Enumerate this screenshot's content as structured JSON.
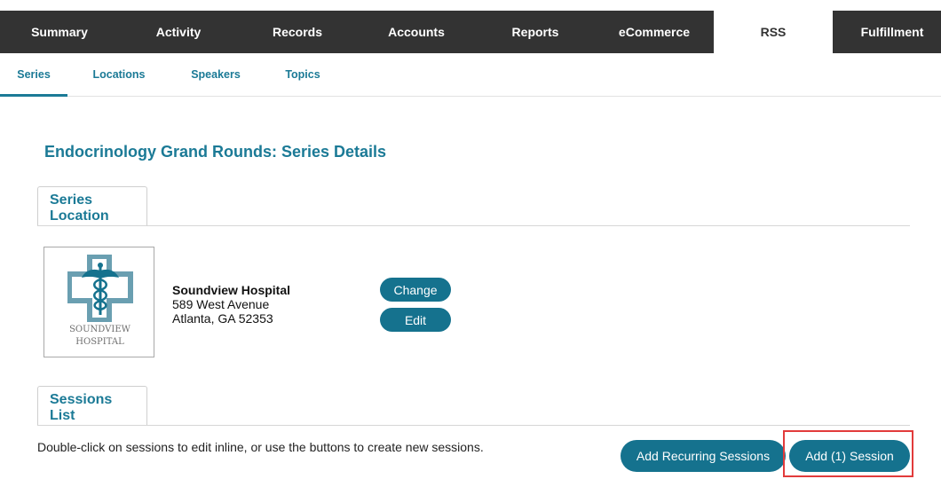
{
  "top_nav": {
    "tabs": [
      "Summary",
      "Activity",
      "Records",
      "Accounts",
      "Reports",
      "eCommerce",
      "RSS",
      "Fulfillment"
    ],
    "active": "RSS"
  },
  "sub_nav": {
    "tabs": [
      "Series",
      "Locations",
      "Speakers",
      "Topics"
    ],
    "active": "Series"
  },
  "page": {
    "title": "Endocrinology Grand Rounds: Series Details"
  },
  "series_location": {
    "tab_label": "Series Location",
    "logo": {
      "line1": "SOUNDVIEW",
      "line2": "HOSPITAL",
      "icon": "medical-cross-caduceus-logo"
    },
    "name": "Soundview Hospital",
    "street": "589 West Avenue",
    "city_line": "Atlanta, GA 52353",
    "change_label": "Change",
    "edit_label": "Edit"
  },
  "sessions_list": {
    "tab_label": "Sessions List",
    "instructions": "Double-click on sessions to edit inline, or use the buttons to create new sessions.",
    "add_recurring_label": "Add Recurring Sessions",
    "add_session_label": "Add (1) Session"
  },
  "colors": {
    "accent": "#1b7a96",
    "button": "#15728e",
    "nav_bg": "#333333",
    "highlight": "#e23b3b"
  }
}
